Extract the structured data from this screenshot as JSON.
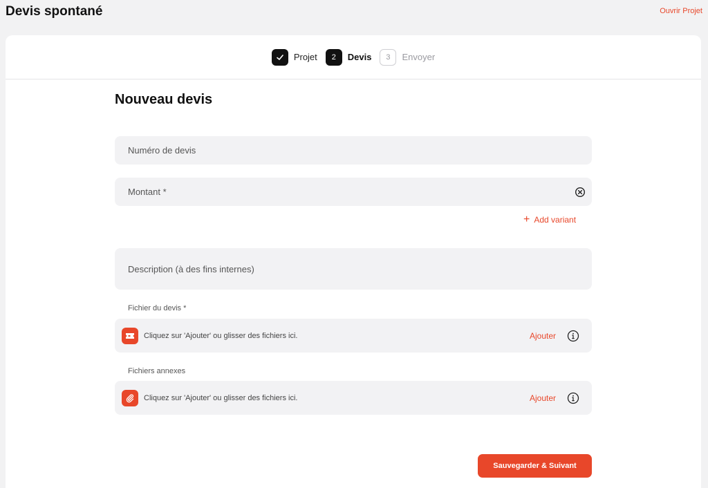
{
  "header": {
    "title": "Devis spontané",
    "open_project_label": "Ouvrir Projet"
  },
  "stepper": {
    "steps": [
      {
        "number": "",
        "label": "Projet",
        "state": "done",
        "icon": "check-icon"
      },
      {
        "number": "2",
        "label": "Devis",
        "state": "active"
      },
      {
        "number": "3",
        "label": "Envoyer",
        "state": "todo"
      }
    ]
  },
  "form": {
    "title": "Nouveau devis",
    "quote_number_placeholder": "Numéro de devis",
    "amount_placeholder": "Montant *",
    "add_variant_label": "Add variant",
    "description_placeholder": "Description (à des fins internes)",
    "quote_file": {
      "label": "Fichier du devis *",
      "hint": "Cliquez sur 'Ajouter' ou glisser des fichiers ici.",
      "add_label": "Ajouter",
      "icon": "ticket-icon"
    },
    "attachments": {
      "label": "Fichiers annexes",
      "hint": "Cliquez sur 'Ajouter' ou glisser des fichiers ici.",
      "add_label": "Ajouter",
      "icon": "paperclip-icon"
    },
    "save_label": "Sauvegarder & Suivant"
  },
  "colors": {
    "accent": "#e8472a",
    "field_bg": "#f2f2f4",
    "page_bg": "#f2f2f3"
  }
}
